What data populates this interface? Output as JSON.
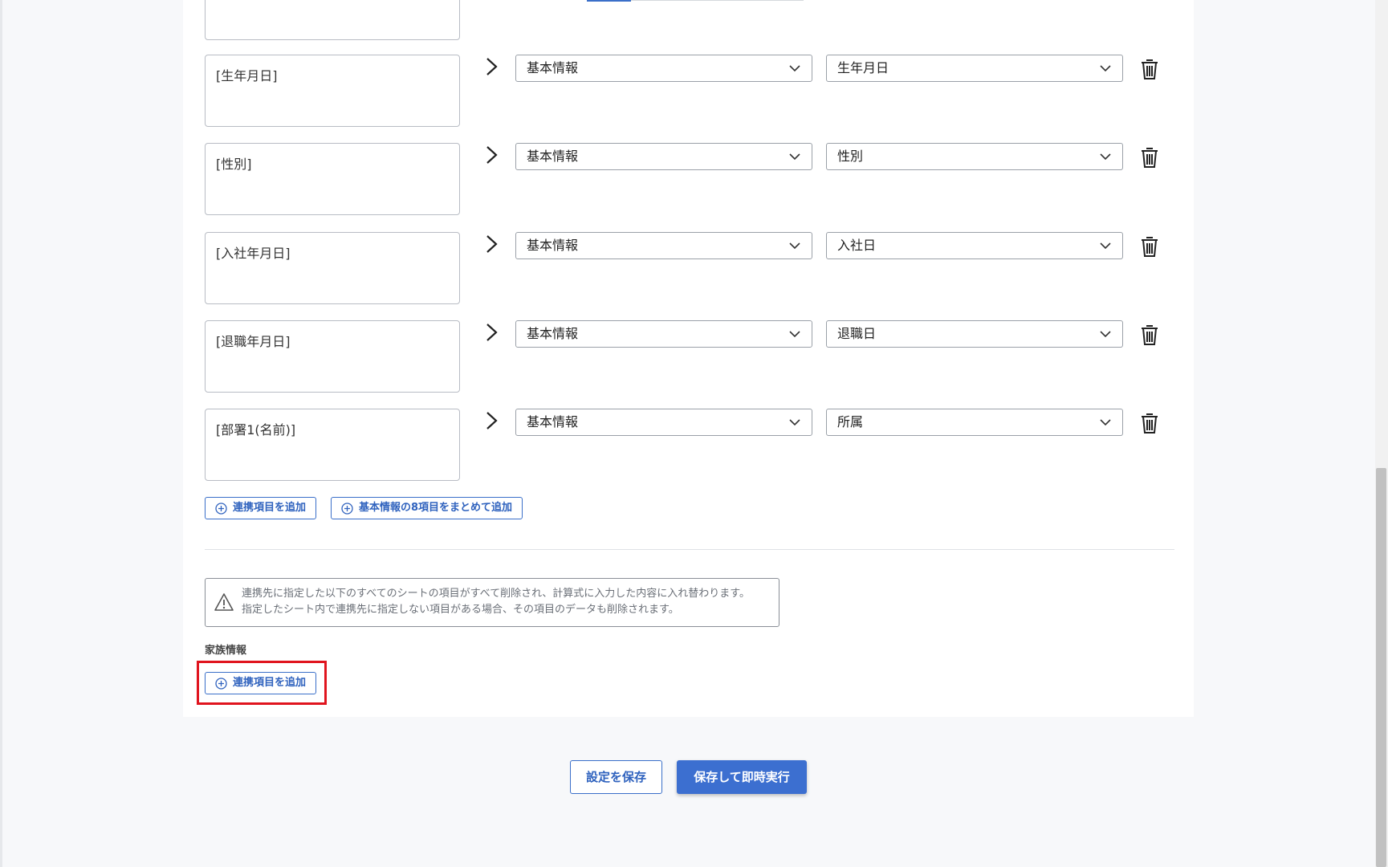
{
  "rows": [
    {
      "formula": "",
      "category": "",
      "field": ""
    },
    {
      "formula": "[生年月日]",
      "category": "基本情報",
      "field": "生年月日"
    },
    {
      "formula": "[性別]",
      "category": "基本情報",
      "field": "性別"
    },
    {
      "formula": "[入社年月日]",
      "category": "基本情報",
      "field": "入社日"
    },
    {
      "formula": "[退職年月日]",
      "category": "基本情報",
      "field": "退職日"
    },
    {
      "formula": "[部署1(名前)]",
      "category": "基本情報",
      "field": "所属"
    }
  ],
  "actions": {
    "add_item": "連携項目を追加",
    "add_basic_bulk": "基本情報の8項目をまとめて追加"
  },
  "notice": {
    "line1": "連携先に指定した以下のすべてのシートの項目がすべて削除され、計算式に入力した内容に入れ替わります。",
    "line2": "指定したシート内で連携先に指定しない項目がある場合、その項目のデータも削除されます。"
  },
  "family_section": {
    "label": "家族情報",
    "add_item": "連携項目を追加"
  },
  "footer": {
    "save_label": "設定を保存",
    "save_run_label": "保存して即時実行"
  },
  "colors": {
    "accent": "#3c6fd0",
    "highlight": "#e0141e"
  },
  "icons": {
    "arrow": "chevron-right-icon",
    "delete": "trash-icon",
    "add": "plus-circle-icon",
    "warning": "warning-icon"
  }
}
